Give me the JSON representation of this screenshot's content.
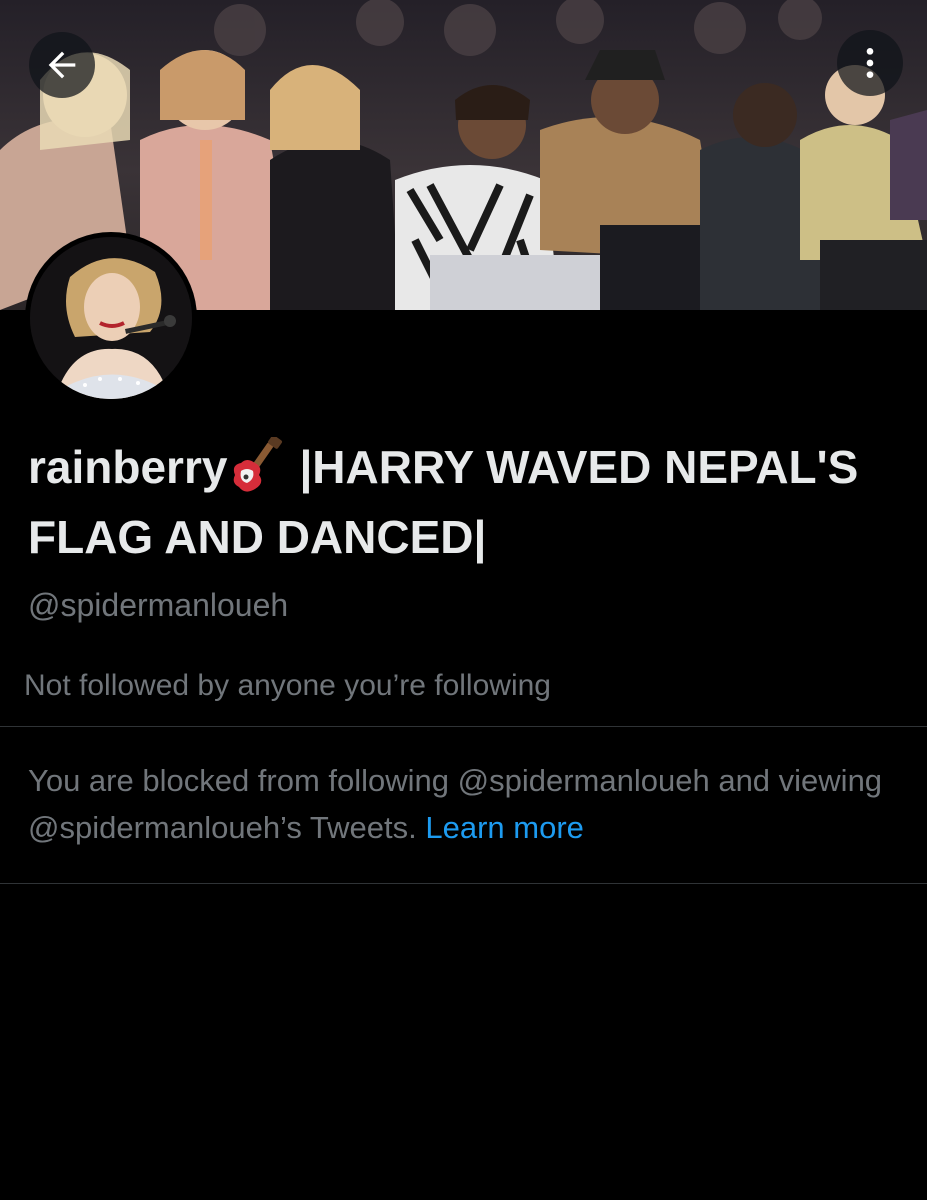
{
  "header": {
    "back_icon": "arrow-left-icon",
    "more_icon": "more-vertical-icon",
    "banner": "front-row-audience-photo"
  },
  "profile": {
    "avatar": "profile-photo",
    "display_name_prefix": "rainberry",
    "display_name_emoji": "guitar-icon",
    "display_name_suffix": "|HARRY WAVED NEPAL'S FLAG AND DANCED|",
    "handle": "@spidermanloueh",
    "followers_note": "Not followed by anyone you’re following"
  },
  "blocked": {
    "message": "You are blocked from following @spidermanloueh and viewing @spidermanloueh’s Tweets.",
    "link_label": "Learn more"
  },
  "colors": {
    "background": "#000000",
    "primary_text": "#e7e9ea",
    "secondary_text": "#71767b",
    "link": "#1d9bf0",
    "divider": "#2f3336"
  }
}
